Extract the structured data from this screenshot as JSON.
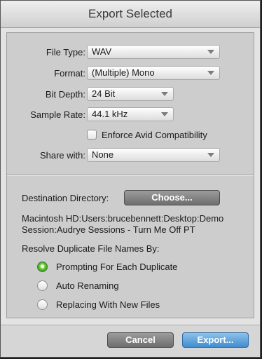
{
  "dialog": {
    "title": "Export Selected"
  },
  "form": {
    "file_type": {
      "label": "File Type:",
      "value": "WAV"
    },
    "format": {
      "label": "Format:",
      "value": "(Multiple) Mono"
    },
    "bit_depth": {
      "label": "Bit Depth:",
      "value": "24 Bit"
    },
    "sample_rate": {
      "label": "Sample Rate:",
      "value": "44.1 kHz"
    },
    "enforce_avid": {
      "label": "Enforce Avid Compatibility",
      "checked": false
    },
    "share_with": {
      "label": "Share with:",
      "value": "None"
    }
  },
  "destination": {
    "label": "Destination Directory:",
    "choose_label": "Choose...",
    "path_line1": "Macintosh HD:Users:brucebennett:Desktop:Demo",
    "path_line2": "Session:Audrye Sessions - Turn Me Off PT"
  },
  "resolve": {
    "label": "Resolve Duplicate File Names By:",
    "options": [
      {
        "label": "Prompting For Each Duplicate",
        "selected": true
      },
      {
        "label": "Auto Renaming",
        "selected": false
      },
      {
        "label": "Replacing With New Files",
        "selected": false
      }
    ]
  },
  "buttons": {
    "cancel": "Cancel",
    "export": "Export..."
  },
  "colors": {
    "accent_blue": "#3f8dd0",
    "radio_selected_green": "#5cc13a"
  },
  "icons": {
    "dropdown": "chevron-down-icon",
    "radio_selected": "radio-selected-icon"
  }
}
